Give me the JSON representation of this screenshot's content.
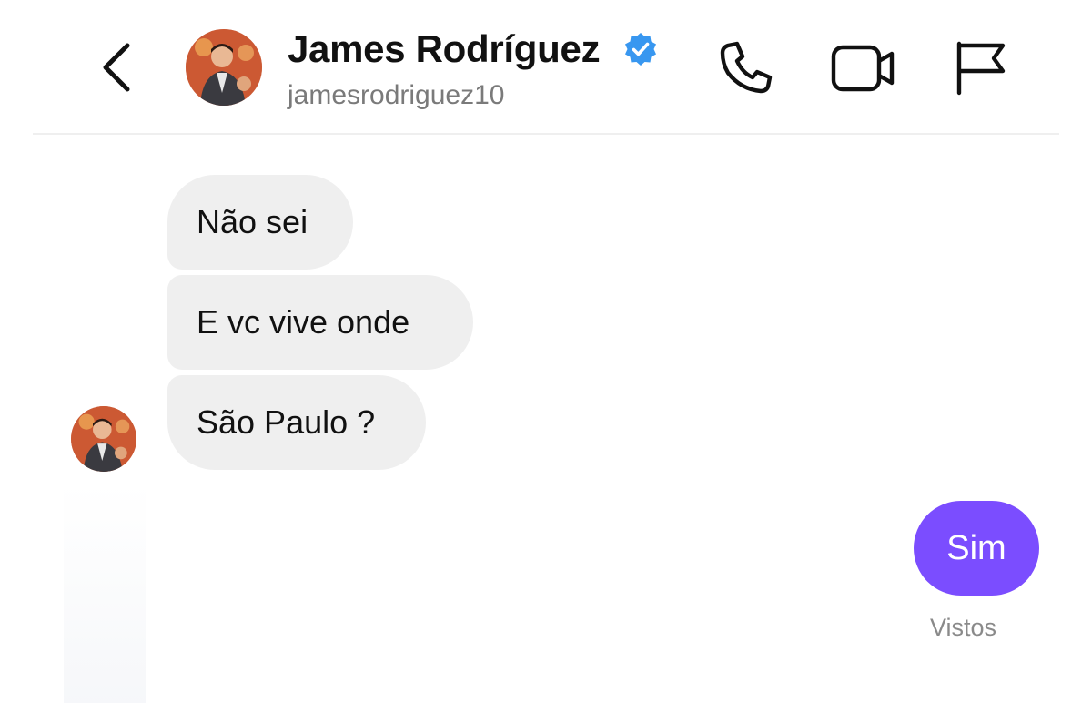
{
  "header": {
    "contact_name": "James Rodríguez",
    "contact_handle": "jamesrodriguez10",
    "icons": {
      "back": "chevron-left-icon",
      "verified": "verified-badge-icon",
      "call": "phone-icon",
      "video": "video-camera-icon",
      "report": "flag-icon"
    }
  },
  "messages": [
    {
      "from": "contact",
      "text": "Não sei"
    },
    {
      "from": "contact",
      "text": "E vc vive onde"
    },
    {
      "from": "contact",
      "text": "São Paulo ?"
    },
    {
      "from": "me",
      "text": "Sim"
    }
  ],
  "status": {
    "seen_label": "Vistos"
  },
  "colors": {
    "accent": "#7b4dff",
    "verified": "#3897f0",
    "incoming_bubble": "#efefef",
    "secondary_text": "#7a7a7a"
  }
}
